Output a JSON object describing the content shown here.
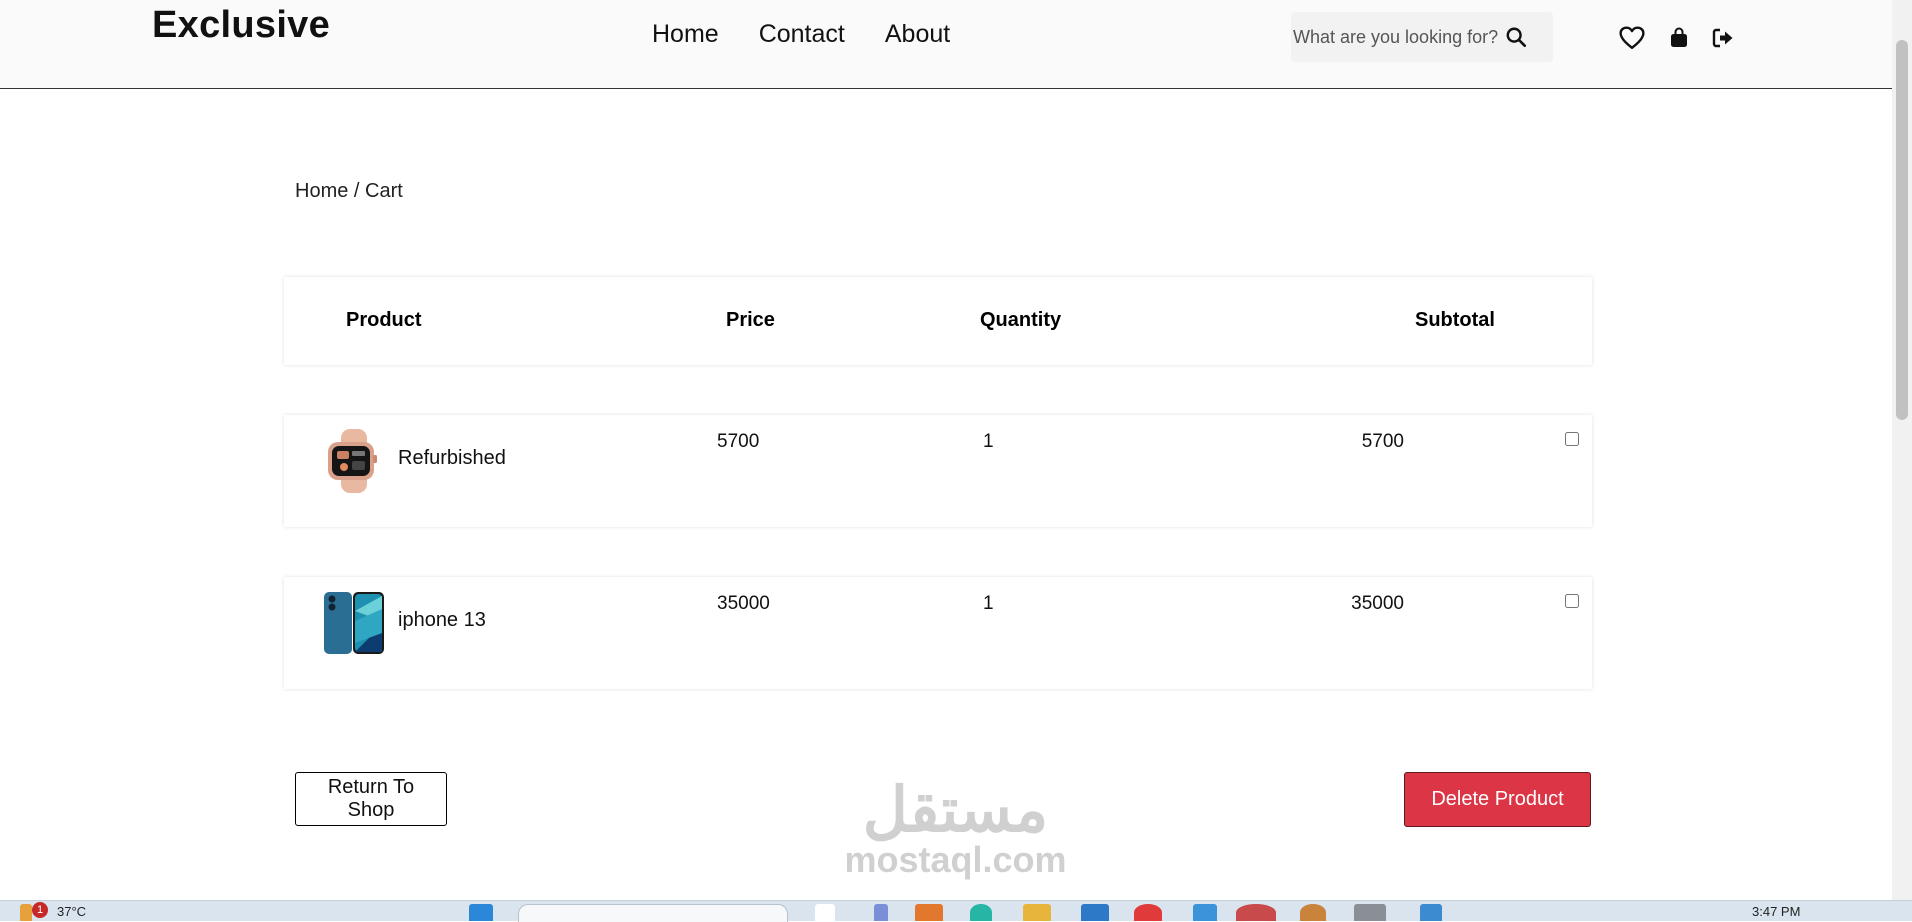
{
  "header": {
    "brand": "Exclusive",
    "nav": [
      "Home",
      "Contact",
      "About"
    ],
    "search_placeholder": "What are you looking for?",
    "icons": [
      "search-icon",
      "heart-icon",
      "shopping-bag-icon",
      "logout-icon"
    ]
  },
  "breadcrumb": "Home / Cart",
  "table": {
    "headers": [
      "Product",
      "Price",
      "Quantity",
      "Subtotal"
    ],
    "rows": [
      {
        "name": "Refurbished",
        "image": "smartwatch-thumbnail",
        "price": "5700",
        "quantity": "1",
        "subtotal": "5700",
        "checked": false
      },
      {
        "name": "iphone 13",
        "image": "iphone-thumbnail",
        "price": "35000",
        "quantity": "1",
        "subtotal": "35000",
        "checked": false
      }
    ]
  },
  "buttons": {
    "return": "Return To Shop",
    "delete": "Delete Product"
  },
  "watermark": {
    "arabic": "مستقل",
    "latin": "mostaql.com"
  },
  "taskbar": {
    "notification_count": "1",
    "temperature": "37°C",
    "time": "3:47 PM"
  },
  "colors": {
    "accent_danger": "#dc3545",
    "header_bg": "#fafafa",
    "search_bg": "#f2f2f2"
  }
}
